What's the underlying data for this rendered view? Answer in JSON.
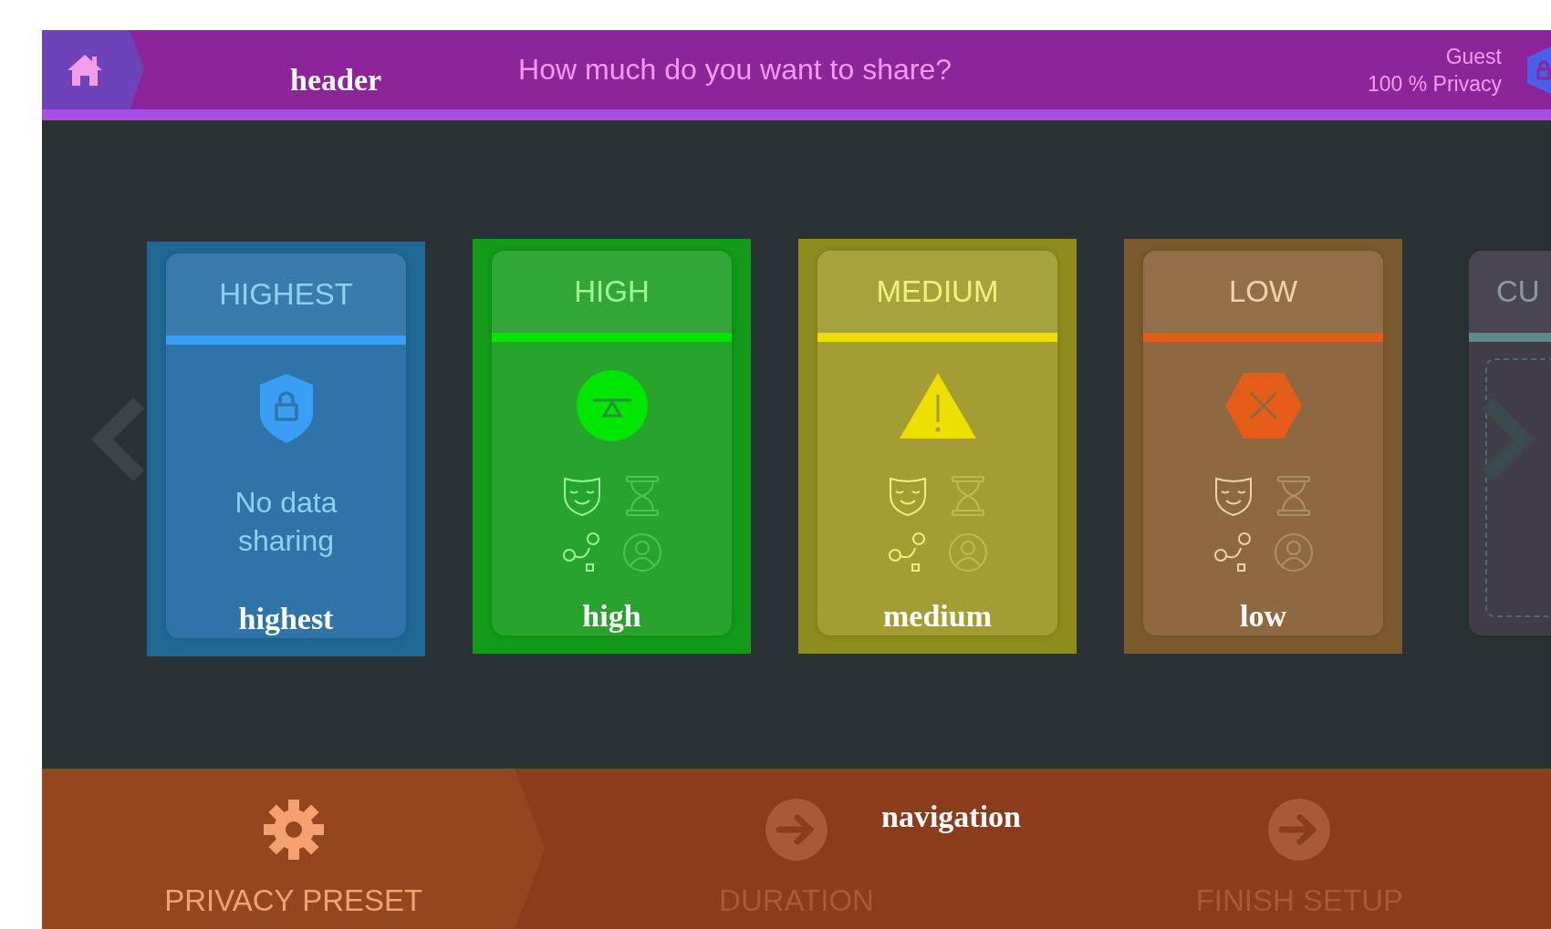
{
  "header": {
    "title": "How much do you want to share?",
    "user": "Guest",
    "privacy": "100 % Privacy",
    "annotation": "header"
  },
  "cards": [
    {
      "kind": "shield",
      "title": "HIGHEST",
      "description": "No data sharing",
      "annotation": "highest",
      "color": "#3a9ef5"
    },
    {
      "kind": "balance",
      "title": "HIGH",
      "annotation": "high",
      "color": "#00e600",
      "features": [
        {
          "kind": "mask",
          "active": true
        },
        {
          "kind": "hourglass",
          "active": false
        },
        {
          "kind": "route",
          "active": true
        },
        {
          "kind": "person",
          "active": false
        }
      ]
    },
    {
      "kind": "warning",
      "title": "MEDIUM",
      "annotation": "medium",
      "color": "#ede000",
      "features": [
        {
          "kind": "mask",
          "active": true
        },
        {
          "kind": "hourglass",
          "active": false
        },
        {
          "kind": "route",
          "active": true
        },
        {
          "kind": "person",
          "active": false
        }
      ]
    },
    {
      "kind": "stop",
      "title": "LOW",
      "annotation": "low",
      "color": "#e55c18",
      "features": [
        {
          "kind": "mask",
          "active": true
        },
        {
          "kind": "hourglass",
          "active": false
        },
        {
          "kind": "route",
          "active": true
        },
        {
          "kind": "person",
          "active": false
        }
      ]
    },
    {
      "kind": "custom",
      "title": "CU",
      "color": "#5d8a8a"
    }
  ],
  "steps": [
    {
      "kind": "gear",
      "label": "PRIVACY PRESET",
      "selected": true
    },
    {
      "kind": "arrow",
      "label": "DURATION",
      "selected": false
    },
    {
      "kind": "arrow",
      "label": "FINISH SETUP",
      "selected": false
    }
  ],
  "navigation_annotation": "navigation"
}
